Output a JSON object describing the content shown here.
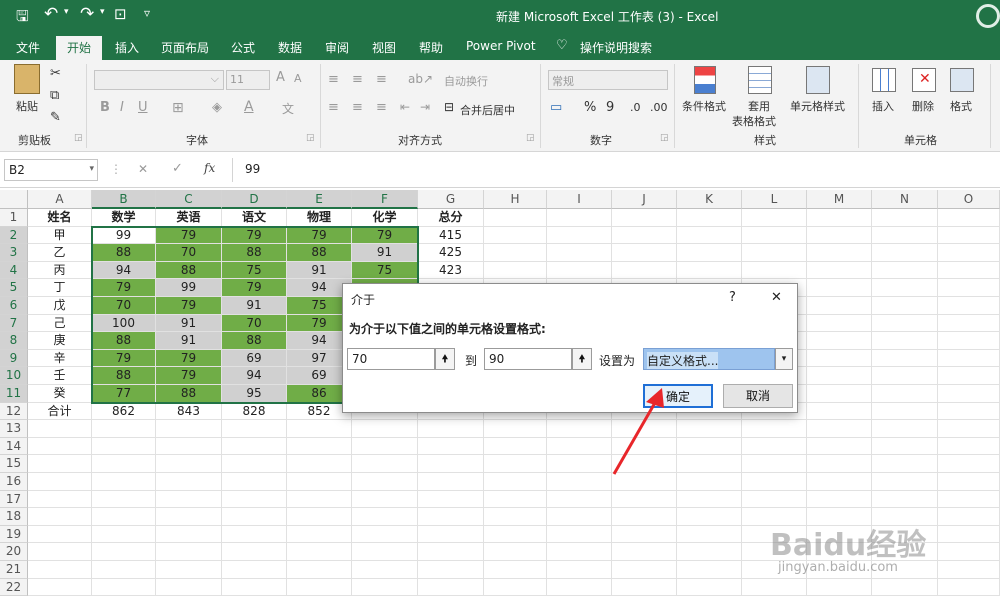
{
  "app": {
    "title": "新建 Microsoft Excel 工作表 (3)  -  Excel",
    "qat": {
      "save": "🖫",
      "undo": "↶",
      "redo": "↷",
      "preview": "⊡",
      "more": "▿"
    }
  },
  "tabs": [
    "文件",
    "开始",
    "插入",
    "页面布局",
    "公式",
    "数据",
    "审阅",
    "视图",
    "帮助",
    "Power Pivot",
    "操作说明搜索"
  ],
  "ribbon": {
    "clipboard": {
      "paste": "粘贴",
      "group": "剪贴板"
    },
    "font": {
      "size": "11",
      "grow": "A",
      "shrink": "A",
      "bold": "B",
      "italic": "I",
      "underline": "U",
      "group": "字体",
      "wen": "文"
    },
    "alignment": {
      "wrap": "自动换行",
      "merge": "合并后居中",
      "group": "对齐方式"
    },
    "number": {
      "format": "常规",
      "percent": "%",
      "comma": "9",
      "group": "数字"
    },
    "styles": {
      "conditional": "条件格式",
      "table": "套用",
      "table2": "表格格式",
      "cell": "单元格样式",
      "group": "样式"
    },
    "cells": {
      "insert": "插入",
      "delete": "删除",
      "format": "格式",
      "group": "单元格"
    }
  },
  "formula_bar": {
    "name_box": "B2",
    "fx": "fx",
    "cancel": "✕",
    "enter": "✓",
    "value": "99"
  },
  "sheet": {
    "columns": [
      "A",
      "B",
      "C",
      "D",
      "E",
      "F",
      "G",
      "H",
      "I",
      "J",
      "K",
      "L",
      "M",
      "N",
      "O"
    ],
    "rows": [
      "1",
      "2",
      "3",
      "4",
      "5",
      "6",
      "7",
      "8",
      "9",
      "10",
      "11",
      "12",
      "13",
      "14",
      "15",
      "16",
      "17",
      "18",
      "19",
      "20",
      "21",
      "22"
    ],
    "header": [
      "姓名",
      "数学",
      "英语",
      "语文",
      "物理",
      "化学",
      "总分"
    ],
    "data": [
      {
        "name": "甲",
        "scores": [
          "99",
          "79",
          "79",
          "79",
          "79"
        ],
        "total": "415",
        "fill": [
          "w",
          "g",
          "g",
          "g",
          "g"
        ]
      },
      {
        "name": "乙",
        "scores": [
          "88",
          "70",
          "88",
          "88",
          "91"
        ],
        "total": "425",
        "fill": [
          "g",
          "g",
          "g",
          "g",
          "gy"
        ]
      },
      {
        "name": "丙",
        "scores": [
          "94",
          "88",
          "75",
          "91",
          "75"
        ],
        "total": "423",
        "fill": [
          "gy",
          "g",
          "g",
          "gy",
          "g"
        ]
      },
      {
        "name": "丁",
        "scores": [
          "79",
          "99",
          "79",
          "94",
          ""
        ],
        "total": "",
        "fill": [
          "g",
          "gy",
          "g",
          "gy",
          "g"
        ]
      },
      {
        "name": "戊",
        "scores": [
          "70",
          "79",
          "91",
          "75",
          ""
        ],
        "total": "",
        "fill": [
          "g",
          "g",
          "gy",
          "g",
          "g"
        ]
      },
      {
        "name": "己",
        "scores": [
          "100",
          "91",
          "70",
          "79",
          ""
        ],
        "total": "",
        "fill": [
          "gy",
          "gy",
          "g",
          "g",
          "g"
        ]
      },
      {
        "name": "庚",
        "scores": [
          "88",
          "91",
          "88",
          "94",
          ""
        ],
        "total": "",
        "fill": [
          "g",
          "gy",
          "g",
          "gy",
          "g"
        ]
      },
      {
        "name": "辛",
        "scores": [
          "79",
          "79",
          "69",
          "97",
          ""
        ],
        "total": "",
        "fill": [
          "g",
          "g",
          "gy",
          "gy",
          "g"
        ]
      },
      {
        "name": "壬",
        "scores": [
          "88",
          "79",
          "94",
          "69",
          ""
        ],
        "total": "",
        "fill": [
          "g",
          "g",
          "gy",
          "gy",
          "g"
        ]
      },
      {
        "name": "癸",
        "scores": [
          "77",
          "88",
          "95",
          "86",
          ""
        ],
        "total": "",
        "fill": [
          "g",
          "g",
          "gy",
          "g",
          "g"
        ]
      }
    ],
    "sum_row": {
      "label": "合计",
      "values": [
        "862",
        "843",
        "828",
        "852"
      ]
    }
  },
  "dialog": {
    "title": "介于",
    "help": "?",
    "close": "✕",
    "prompt": "为介于以下值之间的单元格设置格式:",
    "value_from": "70",
    "to_label": "到",
    "value_to": "90",
    "set_label": "设置为",
    "format_option": "自定义格式...",
    "ok": "确定",
    "cancel": "取消"
  },
  "watermark": {
    "brand": "Baidu经验",
    "url": "jingyan.baidu.com"
  },
  "colors": {
    "accent": "#217346",
    "in_range": "#70ad47",
    "out_range": "#d0d0d0",
    "annotation": "#e8262a"
  }
}
